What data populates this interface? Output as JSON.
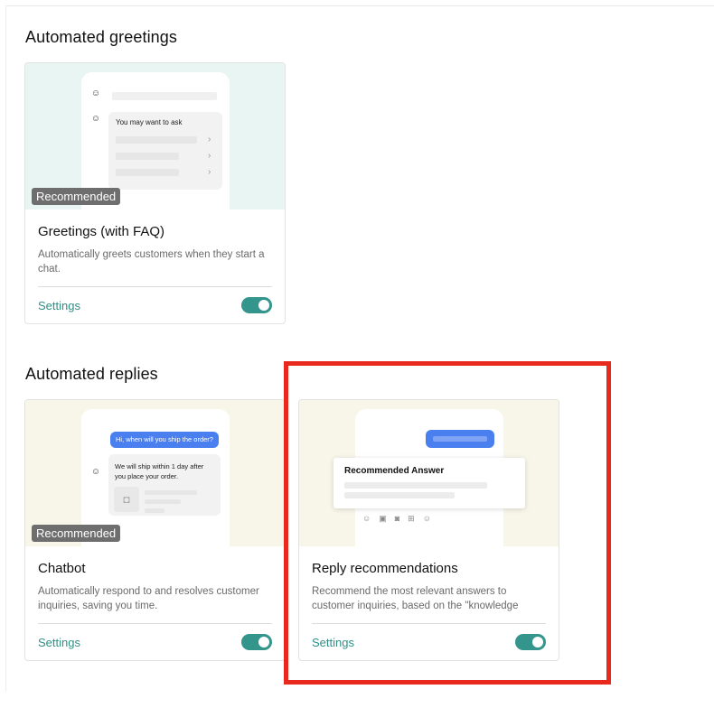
{
  "sections": {
    "greetings": {
      "title": "Automated greetings"
    },
    "replies": {
      "title": "Automated replies"
    }
  },
  "cards": {
    "greetings_faq": {
      "badge": "Recommended",
      "title": "Greetings (with FAQ)",
      "description": "Automatically greets customers when they start a chat.",
      "settings_label": "Settings",
      "enabled": true,
      "preview": {
        "prompt": "You may want to ask"
      }
    },
    "chatbot": {
      "badge": "Recommended",
      "title": "Chatbot",
      "description": "Automatically respond to and resolves customer inquiries, saving you time.",
      "settings_label": "Settings",
      "enabled": true,
      "preview": {
        "question": "Hi, when will you ship the order?",
        "answer_line1": "We will ship within 1 day after",
        "answer_line2": "you place your order."
      }
    },
    "reply_recommendations": {
      "title": "Reply recommendations",
      "description": "Recommend the most relevant answers to customer inquiries, based on the \"knowledge bas...",
      "settings_label": "Settings",
      "enabled": true,
      "preview": {
        "answer_title": "Recommended Answer"
      }
    }
  },
  "icons": [
    "robot-icon",
    "chevron-right-icon",
    "emoji-icon",
    "image-icon",
    "video-icon",
    "product-icon",
    "bag-icon"
  ],
  "colors": {
    "accent": "#33958b",
    "highlight": "#e8291d",
    "badge": "#6e6e6e",
    "bubble": "#4a7ff0"
  }
}
